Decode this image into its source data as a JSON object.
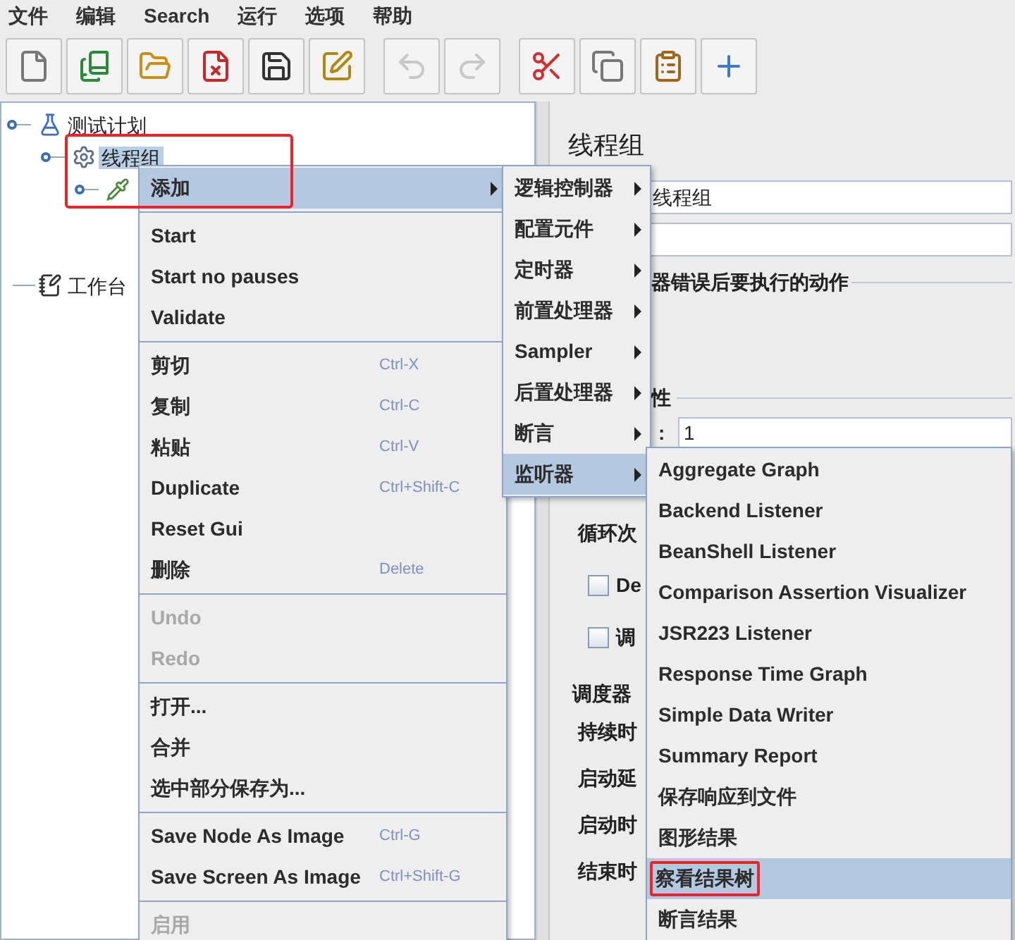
{
  "menu_bar": [
    "文件",
    "编辑",
    "Search",
    "运行",
    "选项",
    "帮助"
  ],
  "toolbar": [
    {
      "kind": "new",
      "disabled": false
    },
    {
      "kind": "templates",
      "disabled": false
    },
    {
      "kind": "open",
      "disabled": false
    },
    {
      "kind": "close",
      "disabled": false
    },
    {
      "kind": "save",
      "disabled": false
    },
    {
      "kind": "save_as",
      "disabled": false
    },
    {
      "kind": "undo",
      "disabled": true
    },
    {
      "kind": "redo",
      "disabled": true
    },
    {
      "kind": "cut",
      "disabled": false
    },
    {
      "kind": "copy",
      "disabled": false
    },
    {
      "kind": "paste",
      "disabled": false
    },
    {
      "kind": "expand",
      "disabled": false
    }
  ],
  "tree": [
    {
      "kind": "plan",
      "label": "测试计划",
      "expanded": true,
      "selected": false,
      "children": [
        {
          "kind": "thread_group",
          "label": "线程组",
          "expanded": true,
          "selected": true,
          "children": [
            {
              "kind": "sampler",
              "expanded": true,
              "selected": false
            }
          ]
        }
      ]
    },
    {
      "kind": "workbench",
      "label": "工作台",
      "expanded": false,
      "selected": false
    }
  ],
  "editor": {
    "title": "线程组",
    "name_value": "线程组",
    "error_action_label": "器错误后要执行的动作",
    "properties_label": "性",
    "threads_colon": ":",
    "threads_value": "1",
    "loop_label": "循环次",
    "checkboxes": [
      {
        "label": "De",
        "checked": false
      },
      {
        "label": "调",
        "checked": false
      }
    ],
    "scheduler_label": "调度器",
    "scheduler_fields": [
      "持续时",
      "启动延",
      "启动时",
      "结束时"
    ]
  },
  "context_menu": [
    {
      "kind": "item",
      "label": "添加",
      "submenu": true,
      "selected": true,
      "disabled": false,
      "annotated": true
    },
    {
      "kind": "separator"
    },
    {
      "kind": "item",
      "label": "Start",
      "selected": false,
      "disabled": false
    },
    {
      "kind": "item",
      "label": "Start no pauses",
      "selected": false,
      "disabled": false
    },
    {
      "kind": "item",
      "label": "Validate",
      "selected": false,
      "disabled": false
    },
    {
      "kind": "separator"
    },
    {
      "kind": "item",
      "label": "剪切",
      "shortcut": "Ctrl-X",
      "selected": false,
      "disabled": false
    },
    {
      "kind": "item",
      "label": "复制",
      "shortcut": "Ctrl-C",
      "selected": false,
      "disabled": false
    },
    {
      "kind": "item",
      "label": "粘贴",
      "shortcut": "Ctrl-V",
      "selected": false,
      "disabled": false
    },
    {
      "kind": "item",
      "label": "Duplicate",
      "shortcut": "Ctrl+Shift-C",
      "selected": false,
      "disabled": false
    },
    {
      "kind": "item",
      "label": "Reset Gui",
      "selected": false,
      "disabled": false
    },
    {
      "kind": "item",
      "label": "删除",
      "shortcut": "Delete",
      "selected": false,
      "disabled": false
    },
    {
      "kind": "separator"
    },
    {
      "kind": "item",
      "label": "Undo",
      "selected": false,
      "disabled": true
    },
    {
      "kind": "item",
      "label": "Redo",
      "selected": false,
      "disabled": true
    },
    {
      "kind": "separator"
    },
    {
      "kind": "item",
      "label": "打开...",
      "selected": false,
      "disabled": false
    },
    {
      "kind": "item",
      "label": "合并",
      "selected": false,
      "disabled": false
    },
    {
      "kind": "item",
      "label": "选中部分保存为...",
      "selected": false,
      "disabled": false
    },
    {
      "kind": "separator"
    },
    {
      "kind": "item",
      "label": "Save Node As Image",
      "shortcut": "Ctrl-G",
      "selected": false,
      "disabled": false
    },
    {
      "kind": "item",
      "label": "Save Screen As Image",
      "shortcut": "Ctrl+Shift-G",
      "selected": false,
      "disabled": false
    },
    {
      "kind": "separator"
    },
    {
      "kind": "item",
      "label": "启用",
      "selected": false,
      "disabled": true
    }
  ],
  "add_submenu": [
    {
      "kind": "item",
      "label": "逻辑控制器",
      "submenu": true,
      "selected": false
    },
    {
      "kind": "item",
      "label": "配置元件",
      "submenu": true,
      "selected": false
    },
    {
      "kind": "item",
      "label": "定时器",
      "submenu": true,
      "selected": false
    },
    {
      "kind": "item",
      "label": "前置处理器",
      "submenu": true,
      "selected": false
    },
    {
      "kind": "item",
      "label": "Sampler",
      "submenu": true,
      "selected": false
    },
    {
      "kind": "item",
      "label": "后置处理器",
      "submenu": true,
      "selected": false
    },
    {
      "kind": "item",
      "label": "断言",
      "submenu": true,
      "selected": false
    },
    {
      "kind": "item",
      "label": "监听器",
      "submenu": true,
      "selected": true
    }
  ],
  "listener_submenu": [
    {
      "kind": "item",
      "label": "Aggregate Graph",
      "selected": false
    },
    {
      "kind": "item",
      "label": "Backend Listener",
      "selected": false
    },
    {
      "kind": "item",
      "label": "BeanShell Listener",
      "selected": false
    },
    {
      "kind": "item",
      "label": "Comparison Assertion Visualizer",
      "selected": false
    },
    {
      "kind": "item",
      "label": "JSR223 Listener",
      "selected": false
    },
    {
      "kind": "item",
      "label": "Response Time Graph",
      "selected": false
    },
    {
      "kind": "item",
      "label": "Simple Data Writer",
      "selected": false
    },
    {
      "kind": "item",
      "label": "Summary Report",
      "selected": false
    },
    {
      "kind": "item",
      "label": "保存响应到文件",
      "selected": false
    },
    {
      "kind": "item",
      "label": "图形结果",
      "selected": false
    },
    {
      "kind": "item",
      "label": "察看结果树",
      "selected": true,
      "annotated": true
    },
    {
      "kind": "item",
      "label": "断言结果",
      "selected": false
    }
  ]
}
